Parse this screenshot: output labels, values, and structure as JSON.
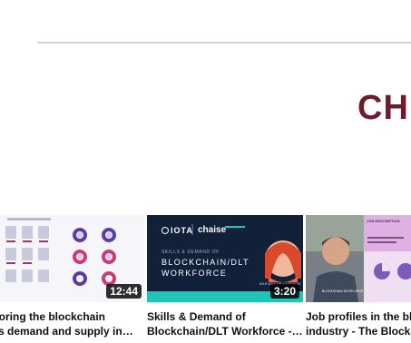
{
  "heading": "CH",
  "videos": [
    {
      "title": "ploring the blockchain\nills demand and supply in…",
      "duration": "12:44"
    },
    {
      "title": "Skills & Demand of\nBlockchain/DLT Workforce -…",
      "duration": "3:20",
      "thumb": {
        "brand_left": "IOTA",
        "brand_right": "chaise",
        "kicker": "SKILLS & DEMAND OF",
        "line1": "BLOCKCHAIN/DLT",
        "line2": "WORKFORCE",
        "person": "MARIANA DE LA ROCHE"
      }
    },
    {
      "title": "Job profiles in the bloc\nindustry - The Blockcha",
      "duration": "",
      "thumb": {
        "person_name": "BLOCKCHAIN DEVELOPER",
        "header_text": "JOB DESCRIPTION"
      }
    }
  ],
  "colors": {
    "heading": "#6e1b2c",
    "navy": "#11213a",
    "teal": "#21c4b8",
    "lilac": "#d9a9dc"
  }
}
